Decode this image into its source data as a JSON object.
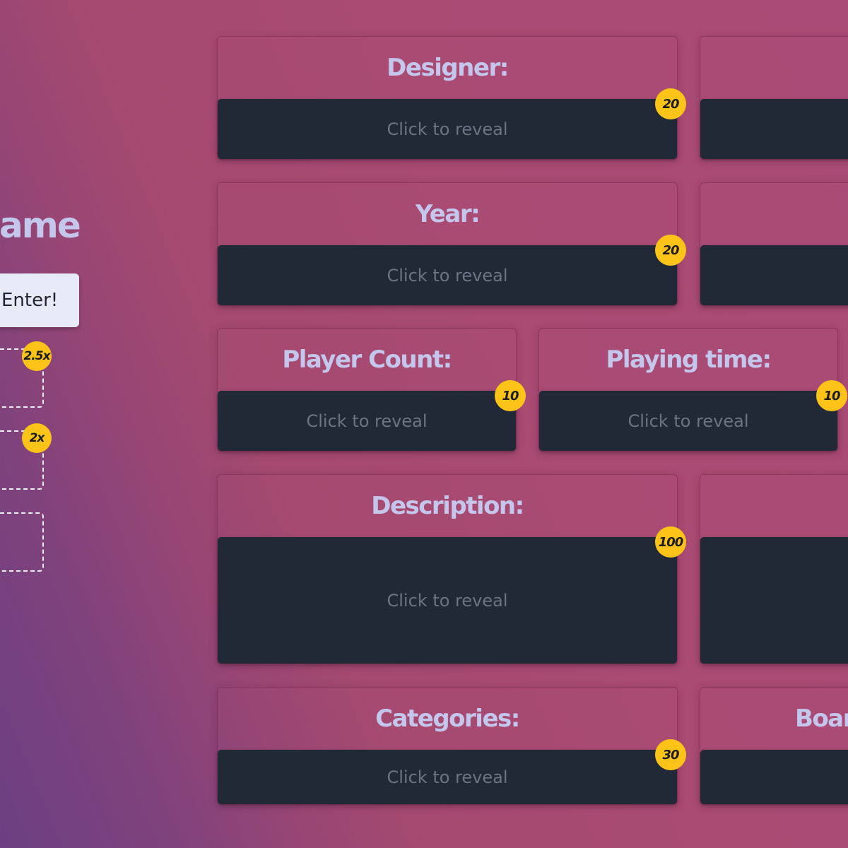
{
  "header": {
    "title": "Game"
  },
  "guess": {
    "enter_label": "Enter!"
  },
  "multipliers": [
    "2.5x",
    "2x"
  ],
  "cards": {
    "designer": {
      "label": "Designer:",
      "reveal": "Click to reveal",
      "points": "20"
    },
    "year": {
      "label": "Year:",
      "reveal": "Click to reveal",
      "points": "20"
    },
    "player_count": {
      "label": "Player Count:",
      "reveal": "Click to reveal",
      "points": "10"
    },
    "playing_time": {
      "label": "Playing time:",
      "reveal": "Click to reveal",
      "points": "10"
    },
    "description": {
      "label": "Description:",
      "reveal": "Click to reveal",
      "points": "100"
    },
    "categories": {
      "label": "Categories:",
      "reveal": "Click to reveal",
      "points": "30"
    },
    "board_partial": {
      "label": "Boar"
    }
  },
  "colors": {
    "reveal_bg": "#212936",
    "badge": "#fcc319",
    "label": "#c4c6ec",
    "button_bg": "#e8eaf8"
  }
}
